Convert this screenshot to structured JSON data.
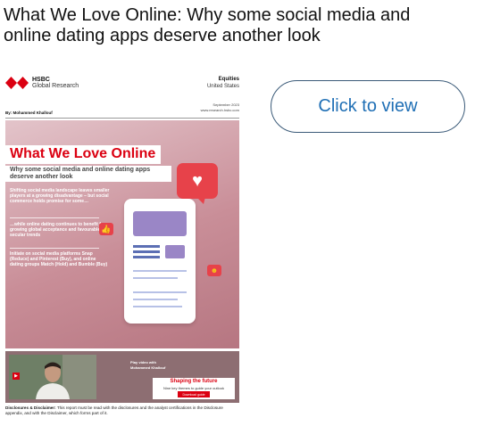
{
  "headline": "What We Love Online: Why some social media and online dating apps deserve another look",
  "cta_label": "Click to view",
  "report": {
    "brand_name": "HSBC",
    "brand_sub": "Global Research",
    "sector": "Equities",
    "region": "United States",
    "date": "September 2023",
    "url": "www.research.hsbc.com",
    "author": "By: Mohammed Khallouf",
    "title": "What We Love Online",
    "subtitle": "Why some social media and online dating apps deserve another look",
    "bullets": [
      "Shifting social media landscape leaves smaller players at a growing disadvantage – but social commerce holds promise for some…",
      "…while online dating continues to benefit from growing global acceptance and favourable secular trends",
      "Initiate on social media platforms Snap (Reduce) and Pinterest (Buy), and online dating groups Match (Hold) and Bumble (Buy)"
    ],
    "video_line1": "Play video with",
    "video_line2": "Mohammed Khallouf",
    "promo_title": "Shaping the future",
    "promo_sub": "Nine key themes to guide your outlook",
    "promo_button": "Download guide",
    "disclaimer_label": "Disclosures & Disclaimer:",
    "disclaimer_text": " This report must be read with the disclosures and the analyst certifications in the Disclosure appendix, and with the Disclaimer, which forms part of it."
  },
  "colors": {
    "brand_red": "#db0011",
    "cta_text": "#1f6fb5",
    "cta_border": "#3a5a78"
  },
  "icons": [
    "hsbc-hexagon-logo",
    "heart-icon",
    "thumbs-up-icon",
    "emoji-sunglasses-icon",
    "play-icon"
  ]
}
